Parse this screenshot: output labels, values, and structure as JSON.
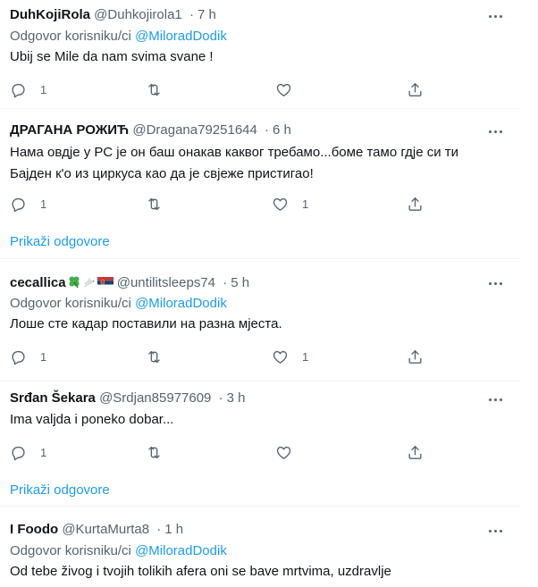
{
  "tweets": [
    {
      "name": "DuhKojiRola",
      "handle": "@Duhkojirola1",
      "dot": "·",
      "time": "7 h",
      "reply_prefix": "Odgovor korisniku/ci",
      "reply_mention": "@MiloradDodik",
      "text": "Ubij se Mile da nam svima svane !",
      "replies": "1",
      "retweets": "",
      "likes": "",
      "icons": [
        "reply-icon",
        "retweet-icon",
        "like-icon",
        "share-icon"
      ]
    },
    {
      "name": "ДРАГАНА РОЖИЋ",
      "handle": "@Dragana79251644",
      "dot": "·",
      "time": "6 h",
      "text_line1": "Нама овдје у РС је он баш онакав каквог требамо...боме тамо гдје си ти",
      "text_line2": "Бајден к'о из циркуса као да је свјеже пристигао!",
      "replies": "1",
      "retweets": "",
      "likes": "1",
      "show_replies": "Prikaži odgovore"
    },
    {
      "name": "cecallica",
      "handle": "@untilitsleeps74",
      "dot": "·",
      "time": "5 h",
      "name_emojis": [
        "four-leaf-clover-icon",
        "dove-icon",
        "serbian-flag-icon"
      ],
      "reply_prefix": "Odgovor korisniku/ci",
      "reply_mention": "@MiloradDodik",
      "text": "Лоше сте кадар поставили на разна мјеста.",
      "replies": "1",
      "retweets": "",
      "likes": "1"
    },
    {
      "name": "Srđan Šekara",
      "handle": "@Srdjan85977609",
      "dot": "·",
      "time": "3 h",
      "text": "Ima valjda i poneko dobar...",
      "replies": "1",
      "retweets": "",
      "likes": "",
      "show_replies": "Prikaži odgovore"
    },
    {
      "name": "I Foodo",
      "handle": "@KurtaMurta8",
      "dot": "·",
      "time": "1 h",
      "reply_prefix": "Odgovor korisniku/ci",
      "reply_mention": "@MiloradDodik",
      "text": "Od tebe živog i tvojih tolikih afera oni se bave mrtvima, uzdravlje"
    }
  ],
  "colors": {
    "text": "#0f1419",
    "secondary": "#536471",
    "link": "#1d9bf0",
    "divider": "#eff3f4"
  }
}
